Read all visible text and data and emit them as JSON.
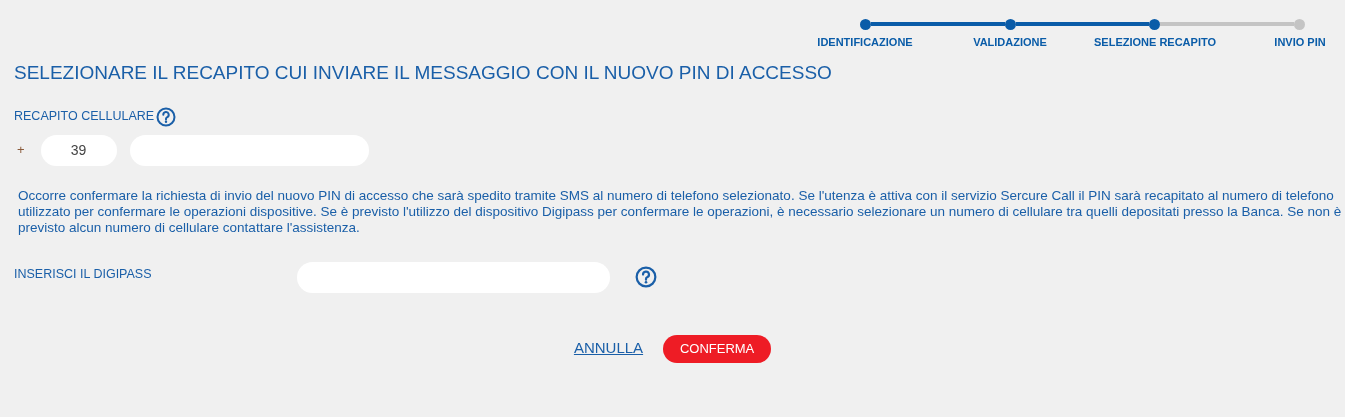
{
  "steps": [
    {
      "label": "IDENTIFICAZIONE",
      "done": true
    },
    {
      "label": "VALIDAZIONE",
      "done": true
    },
    {
      "label": "SELEZIONE RECAPITO",
      "done": true
    },
    {
      "label": "INVIO PIN",
      "done": false
    }
  ],
  "title": "SELEZIONARE IL RECAPITO CUI INVIARE IL MESSAGGIO CON IL NUOVO PIN DI ACCESSO",
  "phone": {
    "label": "RECAPITO CELLULARE",
    "plus": "+",
    "prefix": "39"
  },
  "info": "Occorre confermare la richiesta di invio del nuovo PIN di accesso che sarà spedito tramite SMS al numero di telefono selezionato. Se l'utenza è attiva con il servizio Sercure Call il PIN sarà recapitato al numero di telefono utilizzato per confermare le operazioni dispositive. Se è previsto l'utilizzo del dispositivo Digipass per confermare le operazioni, è necessario selezionare un numero di cellulare tra quelli depositati presso la Banca. Se non è previsto alcun numero di cellulare contattare l'assistenza.",
  "digipass": {
    "label": "INSERISCI IL DIGIPASS"
  },
  "buttons": {
    "cancel": "ANNULLA",
    "confirm": "CONFERMA"
  }
}
